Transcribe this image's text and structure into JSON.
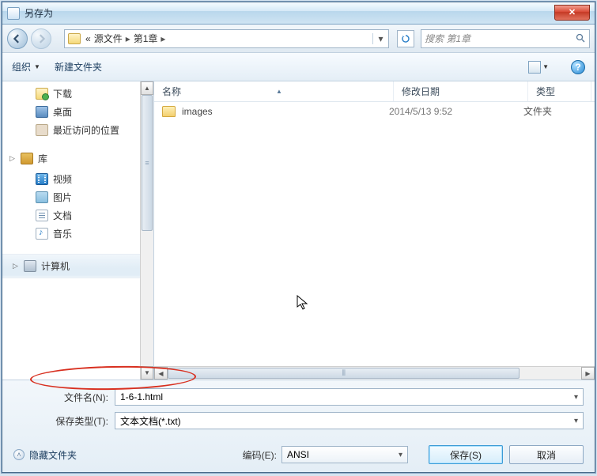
{
  "title": "另存为",
  "breadcrumb": {
    "prefix": "«",
    "part1": "源文件",
    "part2": "第1章",
    "sep": "▸"
  },
  "search": {
    "placeholder": "搜索 第1章"
  },
  "toolbar": {
    "organize": "组织",
    "new_folder": "新建文件夹"
  },
  "sidebar": {
    "downloads": "下载",
    "desktop": "桌面",
    "recent": "最近访问的位置",
    "library": "库",
    "video": "视频",
    "pictures": "图片",
    "documents": "文档",
    "music": "音乐",
    "computer": "计算机"
  },
  "columns": {
    "name": "名称",
    "date": "修改日期",
    "type": "类型"
  },
  "files": [
    {
      "name": "images",
      "date": "2014/5/13 9:52",
      "type": "文件夹"
    }
  ],
  "fields": {
    "filename_label": "文件名(N):",
    "filename_value": "1-6-1.html",
    "filetype_label": "保存类型(T):",
    "filetype_value": "文本文档(*.txt)",
    "encoding_label": "编码(E):",
    "encoding_value": "ANSI"
  },
  "footer": {
    "hide_folders": "隐藏文件夹",
    "save": "保存(S)",
    "cancel": "取消"
  }
}
